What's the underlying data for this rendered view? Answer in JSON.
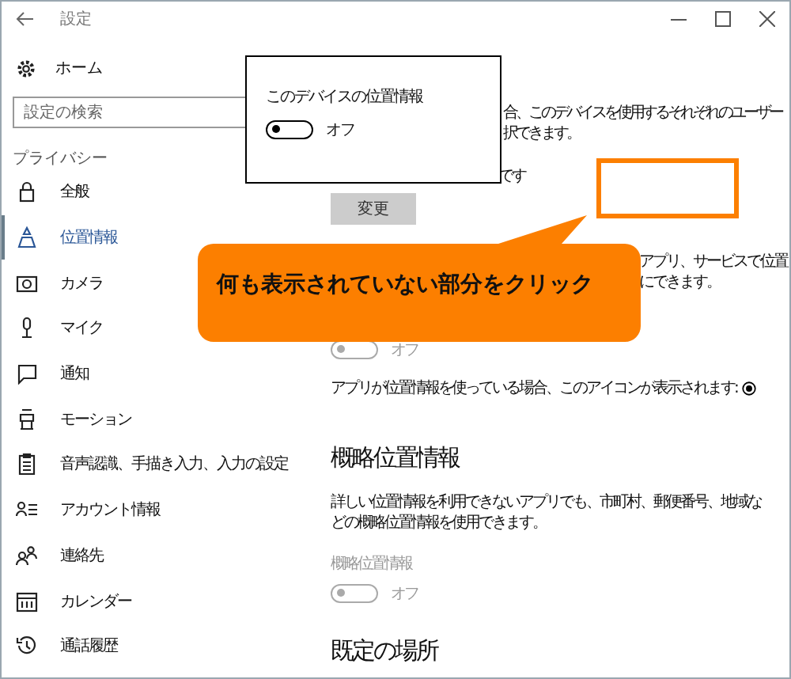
{
  "window": {
    "title": "設定"
  },
  "sidebar": {
    "home": "ホーム",
    "search": {
      "placeholder": "設定の検索"
    },
    "section": "プライバシー",
    "items": [
      {
        "kind": "lock",
        "label": "全般",
        "selected": false
      },
      {
        "kind": "location",
        "label": "位置情報",
        "selected": true
      },
      {
        "kind": "camera",
        "label": "カメラ",
        "selected": false
      },
      {
        "kind": "mic",
        "label": "マイク",
        "selected": false
      },
      {
        "kind": "chat",
        "label": "通知",
        "selected": false
      },
      {
        "kind": "motion",
        "label": "モーション",
        "selected": false
      },
      {
        "kind": "clipboard",
        "label": "音声認識、手描き入力、入力の設定",
        "selected": false
      },
      {
        "kind": "account",
        "label": "アカウント情報",
        "selected": false
      },
      {
        "kind": "contacts",
        "label": "連絡先",
        "selected": false
      },
      {
        "kind": "calendar",
        "label": "カレンダー",
        "selected": false
      },
      {
        "kind": "history",
        "label": "通話履歴",
        "selected": false
      }
    ]
  },
  "content": {
    "fragments_top": [
      "合、このデバイスを使用するそれぞれのユーザー",
      "択できます。"
    ],
    "fragment_mid": "です",
    "change_button": "変更",
    "fragments_lower": [
      "アプリ、サービスで位置",
      "にできます。"
    ],
    "app_toggle": {
      "on": false,
      "disabled": true,
      "label": "オフ"
    },
    "icon_note": "アプリが位置情報を使っている場合、このアイコンが表示されます:",
    "approx_heading": "概略位置情報",
    "approx_description": "詳しい位置情報を利用できないアプリでも、市町村、郵便番号、地域などの概略位置情報を使用できます。",
    "approx_label": "概略位置情報",
    "approx_toggle": {
      "on": false,
      "disabled": true,
      "label": "オフ"
    },
    "default_heading": "既定の場所"
  },
  "popup": {
    "title": "このデバイスの位置情報",
    "toggle": {
      "on": false,
      "disabled": false,
      "label": "オフ"
    }
  },
  "callout": {
    "text": "何も表示されていない部分をクリック"
  }
}
